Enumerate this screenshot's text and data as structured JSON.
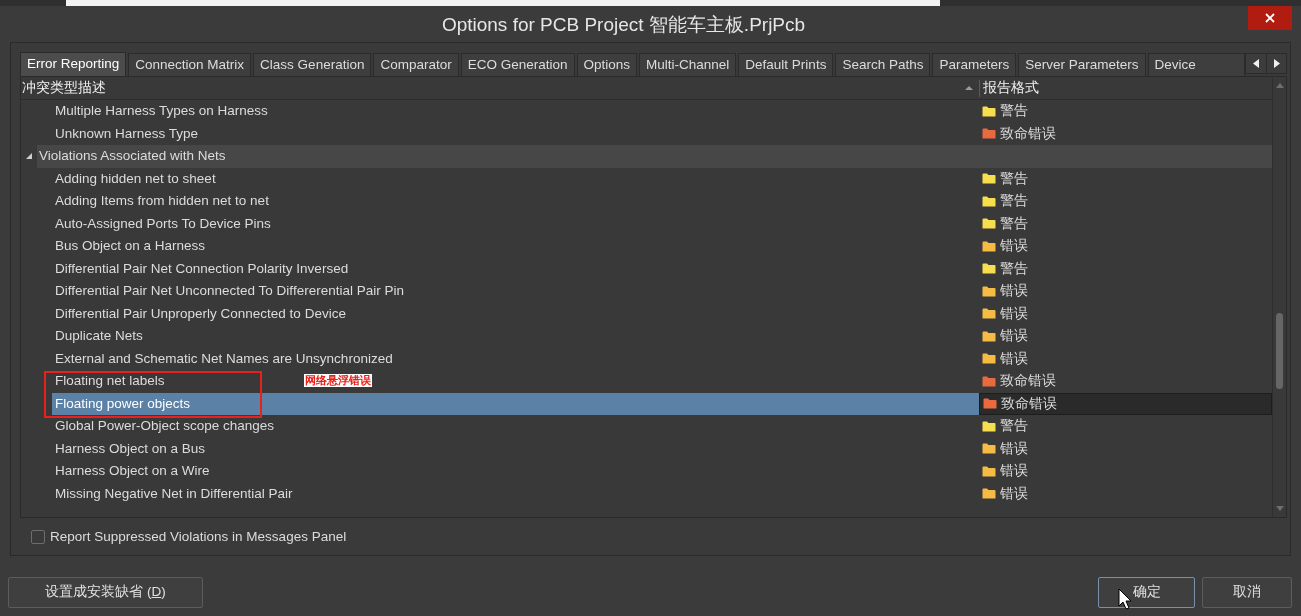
{
  "window": {
    "title": "Options for PCB Project 智能车主板.PrjPcb"
  },
  "tabs": [
    {
      "label": "Error Reporting",
      "selected": true
    },
    {
      "label": "Connection Matrix",
      "selected": false
    },
    {
      "label": "Class Generation",
      "selected": false
    },
    {
      "label": "Comparator",
      "selected": false
    },
    {
      "label": "ECO Generation",
      "selected": false
    },
    {
      "label": "Options",
      "selected": false
    },
    {
      "label": "Multi-Channel",
      "selected": false
    },
    {
      "label": "Default Prints",
      "selected": false
    },
    {
      "label": "Search Paths",
      "selected": false
    },
    {
      "label": "Parameters",
      "selected": false
    },
    {
      "label": "Server Parameters",
      "selected": false
    },
    {
      "label": "Device",
      "selected": false
    }
  ],
  "table": {
    "columns": [
      {
        "label": "冲突类型描述",
        "sorted": true
      },
      {
        "label": "报告格式"
      }
    ],
    "rows": [
      {
        "children": [
          {
            "label": "Multiple Harness Types on Harness",
            "report": "警告",
            "color": "#f7de4e",
            "selected": false
          },
          {
            "label": "Unknown Harness Type",
            "report": "致命错误",
            "color": "#ea6a3f",
            "selected": false
          }
        ]
      },
      {
        "label": "Violations Associated with Nets",
        "expanded": true,
        "selected": false,
        "children": [
          {
            "label": "Adding hidden net to sheet",
            "report": "警告",
            "color": "#f7de4e",
            "selected": false
          },
          {
            "label": "Adding Items from hidden net to net",
            "report": "警告",
            "color": "#f7de4e",
            "selected": false
          },
          {
            "label": "Auto-Assigned Ports To Device Pins",
            "report": "警告",
            "color": "#f7de4e",
            "selected": false
          },
          {
            "label": "Bus Object on a Harness",
            "report": "错误",
            "color": "#f5bb45",
            "selected": false
          },
          {
            "label": "Differential Pair Net Connection Polarity Inversed",
            "report": "警告",
            "color": "#f7de4e",
            "selected": false
          },
          {
            "label": "Differential Pair Net Unconnected To Differerential Pair Pin",
            "report": "错误",
            "color": "#f5bb45",
            "selected": false
          },
          {
            "label": "Differential Pair Unproperly Connected to Device",
            "report": "错误",
            "color": "#f5bb45",
            "selected": false
          },
          {
            "label": "Duplicate Nets",
            "report": "错误",
            "color": "#f5bb45",
            "selected": false
          },
          {
            "label": "External and Schematic Net Names are Unsynchronized",
            "report": "错误",
            "color": "#f5bb45",
            "selected": false
          },
          {
            "label": "Floating net labels",
            "report": "致命错误",
            "color": "#ea6a3f",
            "selected": false
          },
          {
            "label": "Floating power objects",
            "report": "致命错误",
            "color": "#ea6a3f",
            "selected": true
          },
          {
            "label": "Global Power-Object scope changes",
            "report": "警告",
            "color": "#f7de4e",
            "selected": false
          },
          {
            "label": "Harness Object on a Bus",
            "report": "错误",
            "color": "#f5bb45",
            "selected": false
          },
          {
            "label": "Harness Object on a Wire",
            "report": "错误",
            "color": "#f5bb45",
            "selected": false
          },
          {
            "label": "Missing Negative Net in Differential Pair",
            "report": "错误",
            "color": "#f5bb45",
            "selected": false
          }
        ]
      }
    ]
  },
  "annotation": {
    "note": "网络悬浮错误"
  },
  "suppressed_option": {
    "label": "Report Suppressed Violations in Messages Panel",
    "checked": false
  },
  "buttons": [
    {
      "text": "设置成安装缺省 (",
      "access_key": "D",
      "text_end": ")"
    },
    {
      "text": "确定"
    },
    {
      "text": "取消"
    }
  ]
}
